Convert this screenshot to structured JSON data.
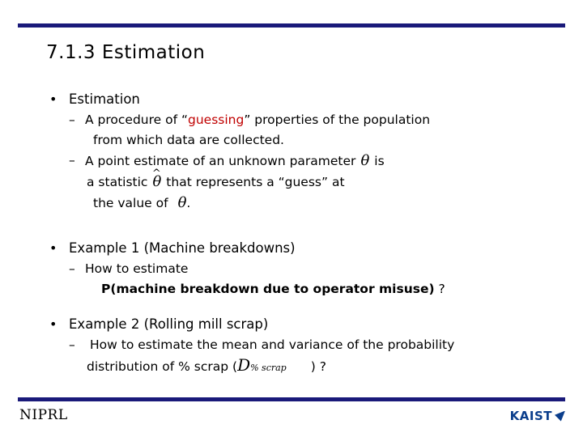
{
  "slide": {
    "title": "7.1.3 Estimation",
    "footer_left": "NIPRL",
    "logo_text": "KAIST",
    "colors": {
      "rule": "#1a1a7a",
      "highlight": "#c00000",
      "logo": "#0b3e8c"
    },
    "content": {
      "b1_label": "Estimation",
      "b1_s1_a": "A procedure of “",
      "b1_s1_hi": "guessing",
      "b1_s1_b": "” properties of the population",
      "b1_s1_cont": "from which data are collected.",
      "b1_s2_a": "A point estimate of an unknown parameter",
      "b1_s2_theta": "θ",
      "b1_s2_b": "is",
      "b1_s2_line2_a": "a statistic",
      "b1_s2_line2_theta": "θ",
      "b1_s2_line2_b": "that represents a “guess” at",
      "b1_s2_line3_a": "the value of",
      "b1_s2_line3_theta": "θ",
      "b1_s2_line3_b": ".",
      "b2_label": "Example 1 (Machine breakdowns)",
      "b2_s1": "How to estimate",
      "b2_bold": "P(machine breakdown due to operator misuse)",
      "b2_qmark": "?",
      "b3_label": "Example 2 (Rolling mill scrap)",
      "b3_s1": "How to estimate the mean and variance of the probability",
      "b3_s1_cont_a": "distribution of % scrap (",
      "b3_sym_big": "D",
      "b3_sym_small": "% scrap",
      "b3_s1_cont_b": ") ?",
      "bullet_dot": "•",
      "dash": "–"
    }
  }
}
